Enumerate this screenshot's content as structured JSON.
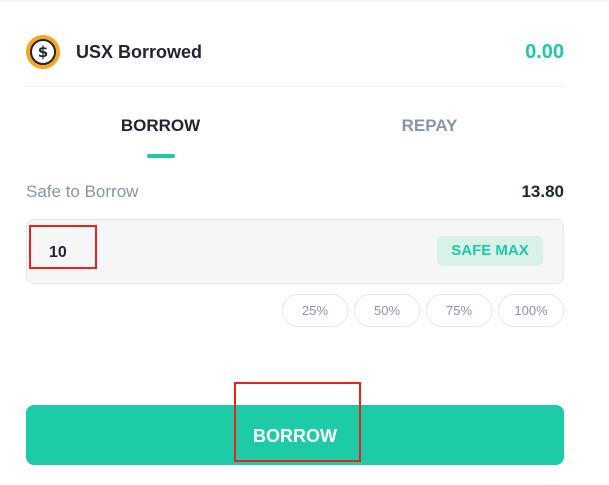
{
  "header": {
    "icon": "dollar-coin-icon",
    "icon_glyph": "$",
    "title": "USX Borrowed",
    "value": "0.00"
  },
  "tabs": [
    {
      "label": "BORROW",
      "active": true
    },
    {
      "label": "REPAY",
      "active": false
    }
  ],
  "safe_to_borrow": {
    "label": "Safe to Borrow",
    "value": "13.80"
  },
  "amount_input": {
    "value": "10",
    "safe_max_label": "SAFE MAX"
  },
  "percent_options": [
    "25%",
    "50%",
    "75%",
    "100%"
  ],
  "submit": {
    "label": "BORROW"
  },
  "colors": {
    "accent": "#1ec9a6",
    "highlight": "#e8231e",
    "text_primary": "#1f2430",
    "text_muted": "#8a94a6"
  }
}
